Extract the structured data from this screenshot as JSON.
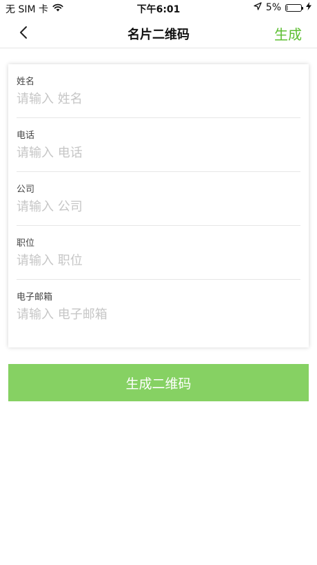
{
  "status_bar": {
    "carrier": "无 SIM 卡",
    "time": "下午6:01",
    "battery_percent": "5%",
    "battery_level": 0.05,
    "icons": [
      "wifi-icon",
      "location-arrow-icon",
      "battery-icon",
      "charging-bolt-icon"
    ]
  },
  "nav": {
    "back_icon": "chevron-left-icon",
    "title": "名片二维码",
    "action_label": "生成"
  },
  "form": {
    "fields": [
      {
        "label": "姓名",
        "placeholder": "请输入 姓名",
        "value": ""
      },
      {
        "label": "电话",
        "placeholder": "请输入 电话",
        "value": ""
      },
      {
        "label": "公司",
        "placeholder": "请输入 公司",
        "value": ""
      },
      {
        "label": "职位",
        "placeholder": "请输入 职位",
        "value": ""
      },
      {
        "label": "电子邮箱",
        "placeholder": "请输入 电子邮箱",
        "value": ""
      }
    ]
  },
  "generate_button": {
    "label": "生成二维码"
  },
  "colors": {
    "accent_green": "#5cbf31",
    "button_green": "#86d163",
    "placeholder": "#c6c6c6",
    "divider": "#e6e6e6"
  }
}
